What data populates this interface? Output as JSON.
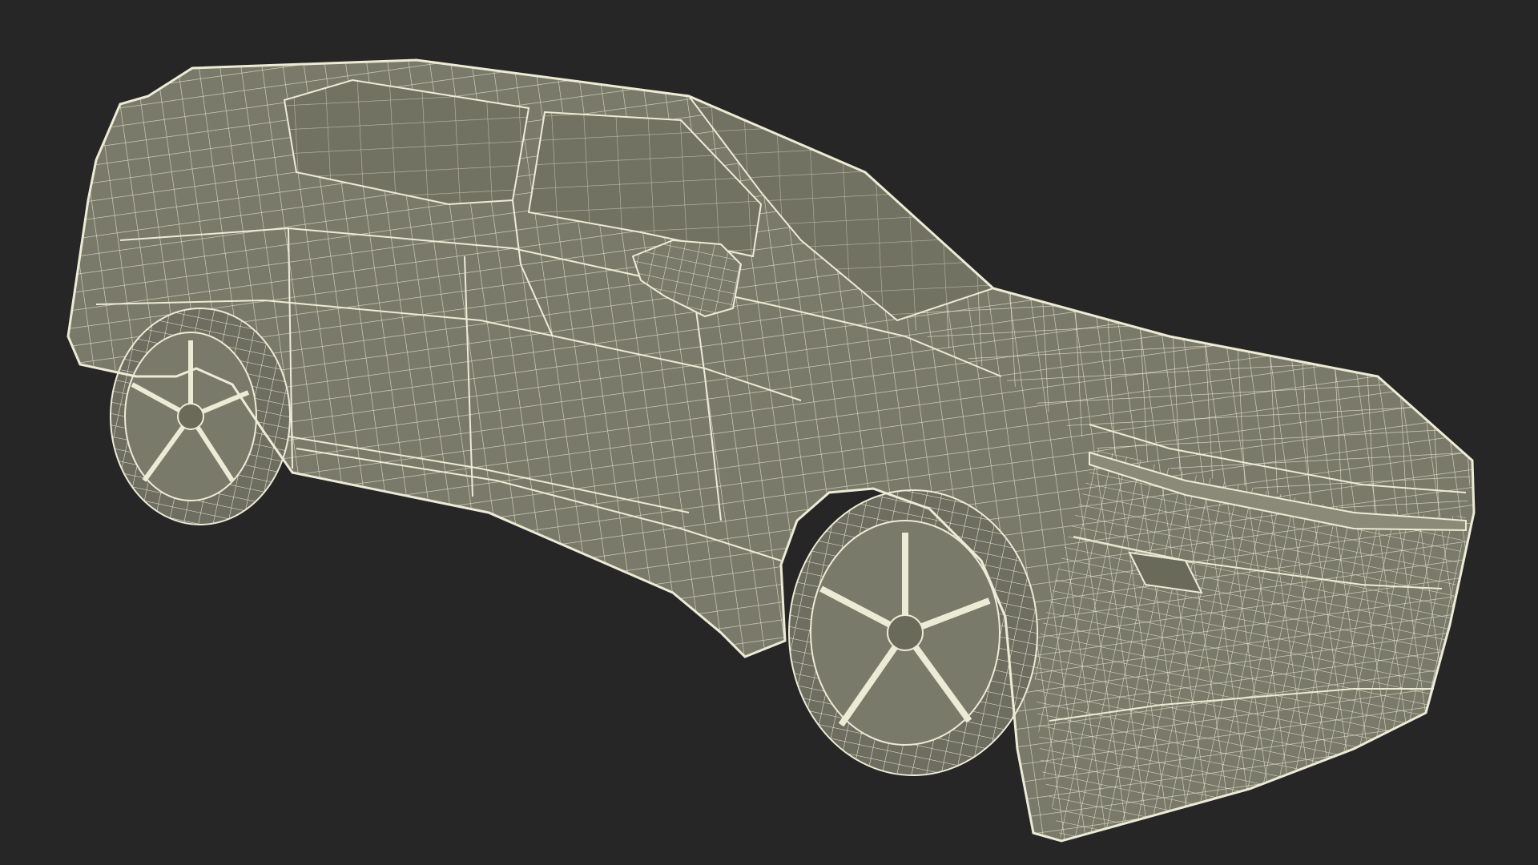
{
  "scene": {
    "subject": "wireframe-suv",
    "background_color": "#262626",
    "body_color": "#7a7a6a",
    "body_shade_color": "#6a6a5b",
    "glass_color": "#727262",
    "wire_color": "#ecebd6",
    "tire_color": "#6d6d60"
  }
}
